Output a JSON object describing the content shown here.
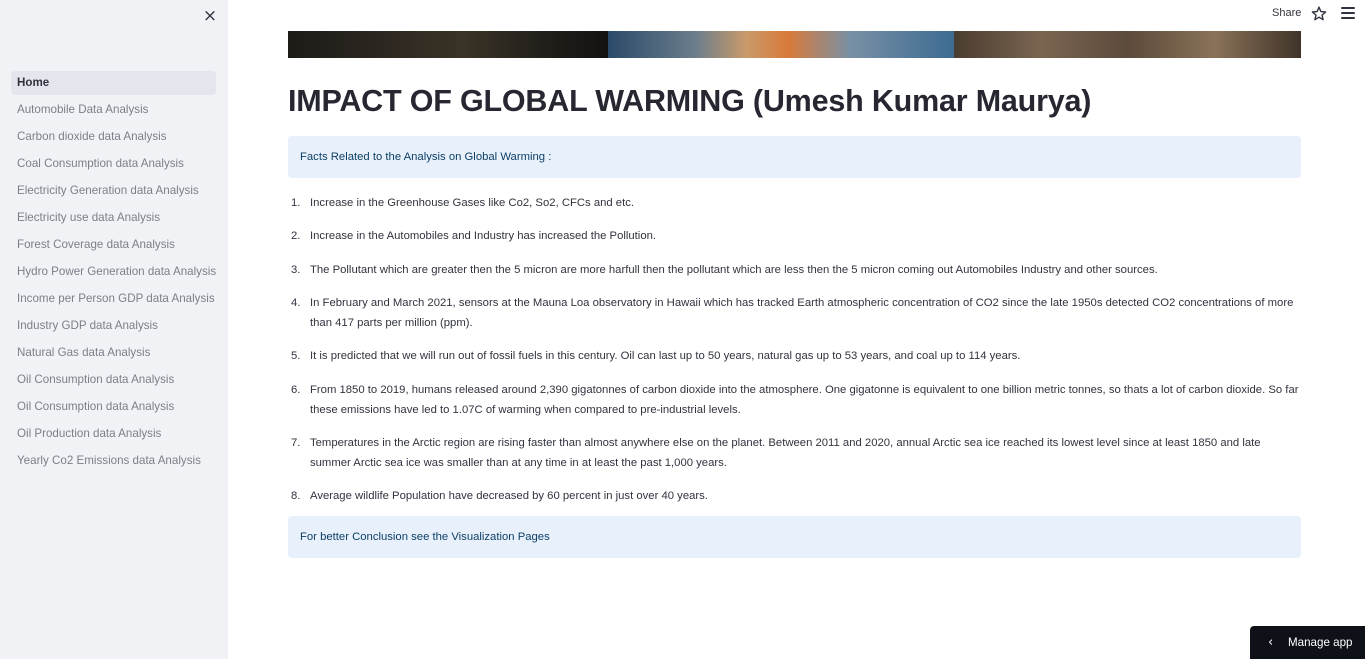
{
  "sidebar": {
    "close_icon": "×",
    "items": [
      {
        "label": "Home",
        "active": true
      },
      {
        "label": "Automobile Data Analysis"
      },
      {
        "label": "Carbon dioxide data Analysis"
      },
      {
        "label": "Coal Consumption data Analysis"
      },
      {
        "label": "Electricity Generation data Analysis"
      },
      {
        "label": "Electricity use data Analysis"
      },
      {
        "label": "Forest Coverage data Analysis"
      },
      {
        "label": "Hydro Power Generation data Analysis"
      },
      {
        "label": "Income per Person GDP data Analysis"
      },
      {
        "label": "Industry GDP data Analysis"
      },
      {
        "label": "Natural Gas data Analysis"
      },
      {
        "label": "Oil Consumption data Analysis"
      },
      {
        "label": "Oil Consumption data Analysis"
      },
      {
        "label": "Oil Production data Analysis"
      },
      {
        "label": "Yearly Co2 Emissions data Analysis"
      }
    ]
  },
  "header": {
    "share_label": "Share",
    "star_icon": "star-icon",
    "menu_icon": "hamburger-menu-icon"
  },
  "main": {
    "title": "IMPACT OF GLOBAL WARMING (Umesh Kumar Maurya)",
    "info_top": "Facts Related to the Analysis on Global Warming :",
    "facts": [
      {
        "num": "1.",
        "text": "Increase in the Greenhouse Gases like Co2, So2, CFCs and etc."
      },
      {
        "num": "2.",
        "text": "Increase in the Automobiles and Industry has increased the Pollution."
      },
      {
        "num": "3.",
        "text": "The Pollutant which are greater then the 5 micron are more harfull then the pollutant which are less then the 5 micron coming out Automobiles Industry and other sources."
      },
      {
        "num": "4.",
        "text": "In February and March 2021, sensors at the Mauna Loa observatory in Hawaii which has tracked Earth atmospheric concentration of CO2 since the late 1950s detected CO2 concentrations of more than 417 parts per million (ppm)."
      },
      {
        "num": "5.",
        "text": "It is predicted that we will run out of fossil fuels in this century. Oil can last up to 50 years, natural gas up to 53 years, and coal up to 114 years."
      },
      {
        "num": "6.",
        "text": "From 1850 to 2019, humans released around 2,390 gigatonnes of carbon dioxide into the atmosphere. One gigatonne is equivalent to one billion metric tonnes, so thats a lot of carbon dioxide. So far these emissions have led to 1.07C of warming when compared to pre-industrial levels."
      },
      {
        "num": "7.",
        "text": "Temperatures in the Arctic region are rising faster than almost anywhere else on the planet. Between 2011 and 2020, annual Arctic sea ice reached its lowest level since at least 1850 and late summer Arctic sea ice was smaller than at any time in at least the past 1,000 years."
      },
      {
        "num": "8.",
        "text": "Average wildlife Population have decreased by 60 percent in just over 40 years."
      }
    ],
    "info_bottom": "For better Conclusion see the Visualization Pages"
  },
  "manage_app": {
    "chevron": "‹",
    "label": "Manage app"
  }
}
